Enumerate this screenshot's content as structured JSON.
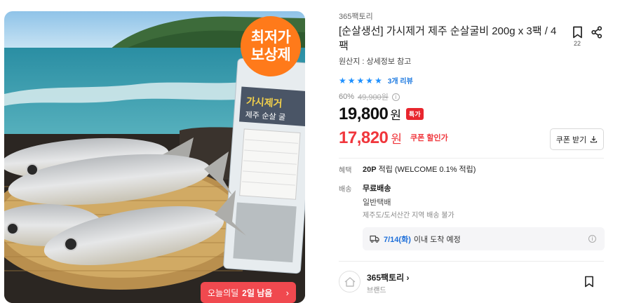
{
  "image": {
    "badge_line1": "최저가",
    "badge_line2": "보상제",
    "package_text": "가시제거 제주 순살 굴",
    "deal_prefix": "오늘의딜",
    "deal_remaining": "2일 남음",
    "deal_arrow": "›"
  },
  "product": {
    "seller": "365팩토리",
    "title": "[순살생선] 가시제거 제주 순살굴비 200g x 3팩 / 4팩",
    "bookmark_count": "22",
    "origin": "원산지 : 상세정보 참고",
    "rating": 5,
    "review_count": "3개 리뷰",
    "discount_rate": "60%",
    "original_price": "49,900원",
    "price": "19,800",
    "price_unit": "원",
    "special_badge": "특가",
    "coupon_price": "17,820",
    "coupon_price_unit": "원",
    "coupon_label": "쿠폰 할인가",
    "coupon_button": "쿠폰 받기"
  },
  "benefit": {
    "label": "혜택",
    "points": "20P",
    "text": "적립 (WELCOME 0.1% 적립)"
  },
  "shipping": {
    "label": "배송",
    "fee": "무료배송",
    "type": "일반택배",
    "note": "제주도/도서산간 지역 배송 불가",
    "arrival_date": "7/14(화)",
    "arrival_text": "이내 도착 예정"
  },
  "brand": {
    "name": "365팩토리",
    "arrow": "›",
    "sub": "브랜드"
  },
  "colors": {
    "accent_blue": "#1e90ff",
    "sale_red": "#f0363c",
    "badge_orange": "#ff7a1a"
  }
}
